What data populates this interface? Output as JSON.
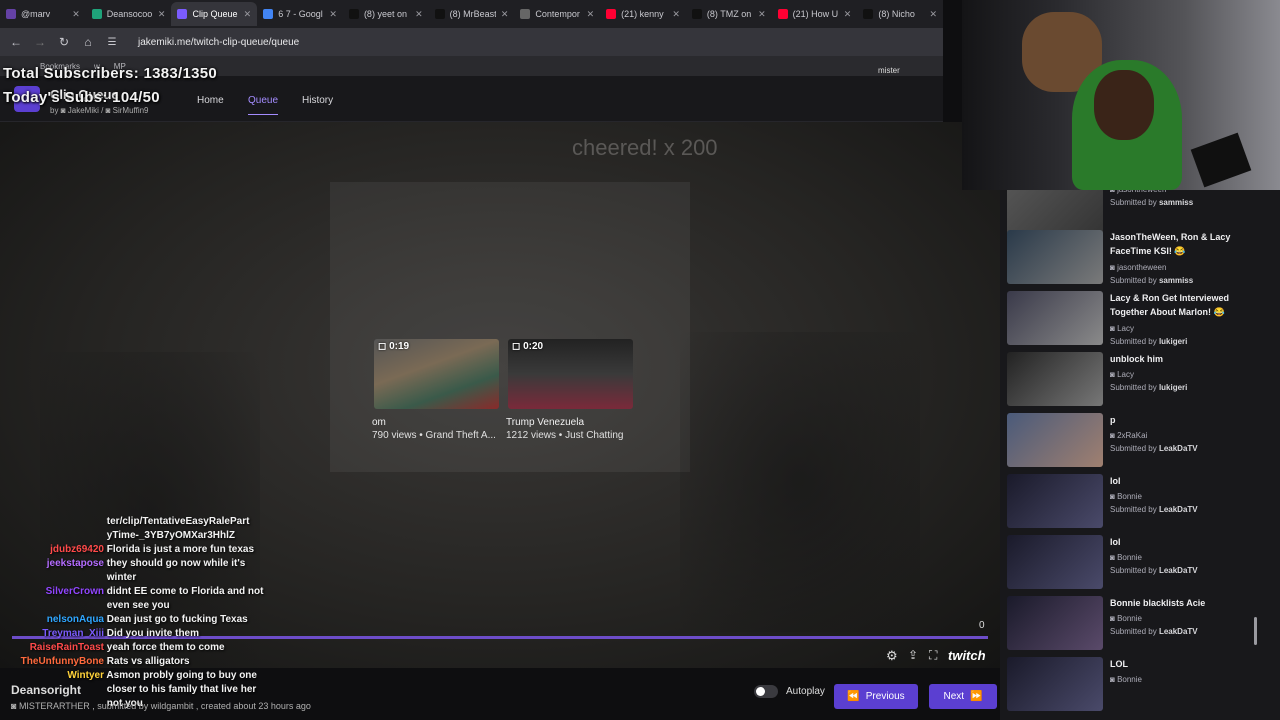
{
  "browser": {
    "tabs": [
      {
        "label": "@marv",
        "color": "#6441a5"
      },
      {
        "label": "Deansocoo",
        "color": "#1fa37a"
      },
      {
        "label": "Clip Queue",
        "color": "#7b5cff",
        "active": true
      },
      {
        "label": "6 7 - Googl",
        "color": "#4285f4"
      },
      {
        "label": "(8) yeet on",
        "color": "#111111"
      },
      {
        "label": "(8) MrBeast",
        "color": "#111111"
      },
      {
        "label": "Contempor",
        "color": "#666666"
      },
      {
        "label": "(21) kenny",
        "color": "#ff0033"
      },
      {
        "label": "(8) TMZ on",
        "color": "#111111"
      },
      {
        "label": "(21) How U",
        "color": "#ff0033"
      },
      {
        "label": "(8) Nicho",
        "color": "#111111"
      }
    ],
    "url": "jakemiki.me/twitch-clip-queue/queue",
    "bookmarks": [
      "Bookmarks",
      "w",
      "MP"
    ]
  },
  "overlay": {
    "total_subs": "Total Subscribers: 1383/1350",
    "todays_subs": "Today's Subs: 104/50",
    "cheer": "cheered! x 200"
  },
  "app": {
    "title": "Clip Queue",
    "credits_by": "by",
    "credit_1": "JakeMiki",
    "credit_2": "SirMuffin9",
    "nav": [
      "Home",
      "Queue",
      "History"
    ],
    "user": "mister"
  },
  "clips": [
    {
      "duration": "0:19",
      "title": "om",
      "meta": "790 views • Grand Theft A..."
    },
    {
      "duration": "0:20",
      "title": "Trump Venezuela",
      "meta": "1212 views • Just Chatting"
    }
  ],
  "player": {
    "count": "0",
    "creator": "Deansoright",
    "byline": "MISTERARTHER , submitted by wildgambit , created about 23 hours ago",
    "autoplay": "Autoplay",
    "previous": "Previous",
    "next": "Next",
    "brand": "twitch"
  },
  "chat": [
    {
      "user": "",
      "text": "ter/clip/TentativeEasyRalePart",
      "color": "#cccccc"
    },
    {
      "user": "",
      "text": "yTime-_3YB7yOMXar3HhlZ",
      "color": "#cccccc"
    },
    {
      "user": "jdubz69420",
      "text": "Florida is just a more fun texas",
      "color": "#ff4a4a"
    },
    {
      "user": "jeekstapose",
      "text": "they should go now while it's",
      "color": "#b36bff"
    },
    {
      "user": "",
      "text": "winter",
      "color": "#cccccc"
    },
    {
      "user": "SilverCrown",
      "text": "didnt EE come to Florida and not",
      "color": "#9146ff"
    },
    {
      "user": "",
      "text": "even see you",
      "color": "#cccccc"
    },
    {
      "user": "nelsonAqua",
      "text": "Dean just go to fucking Texas",
      "color": "#2fa6ff"
    },
    {
      "user": "Treyman_Xiii",
      "text": "Did you invite them",
      "color": "#7a5cff"
    },
    {
      "user": "RaiseRainToast",
      "text": "yeah force them to come",
      "color": "#ff4a4a"
    },
    {
      "user": "TheUnfunnyBone",
      "text": "Rats vs alligators",
      "color": "#ff6a3d"
    },
    {
      "user": "Wintyer",
      "text": "Asmon probly going to buy one",
      "color": "#ffd23a"
    },
    {
      "user": "",
      "text": "closer to his family that live her",
      "color": "#cccccc"
    },
    {
      "user": "",
      "text": "not you",
      "color": "#cccccc"
    }
  ],
  "queue": [
    {
      "title": "",
      "creator": "jasontheween",
      "submitter": "sammiss"
    },
    {
      "title": "JasonTheWeen, Ron & Lacy FaceTime KSI! 😂",
      "creator": "jasontheween",
      "submitter": "sammiss"
    },
    {
      "title": "Lacy & Ron Get Interviewed Together About Marlon! 😂",
      "creator": "Lacy",
      "submitter": "lukigeri"
    },
    {
      "title": "unblock him",
      "creator": "Lacy",
      "submitter": "lukigeri"
    },
    {
      "title": "p",
      "creator": "2xRaKai",
      "submitter": "LeakDaTV"
    },
    {
      "title": "lol",
      "creator": "Bonnie",
      "submitter": "LeakDaTV"
    },
    {
      "title": "lol",
      "creator": "Bonnie",
      "submitter": "LeakDaTV"
    },
    {
      "title": "Bonnie blacklists Acie",
      "creator": "Bonnie",
      "submitter": "LeakDaTV"
    },
    {
      "title": "LOL",
      "creator": "Bonnie",
      "submitter": ""
    }
  ],
  "queue_labels": {
    "submitted_by": "Submitted by"
  },
  "colors": {
    "accent": "#5b3fd1",
    "bg": "#0e0e10",
    "sidebar": "#18181b"
  }
}
